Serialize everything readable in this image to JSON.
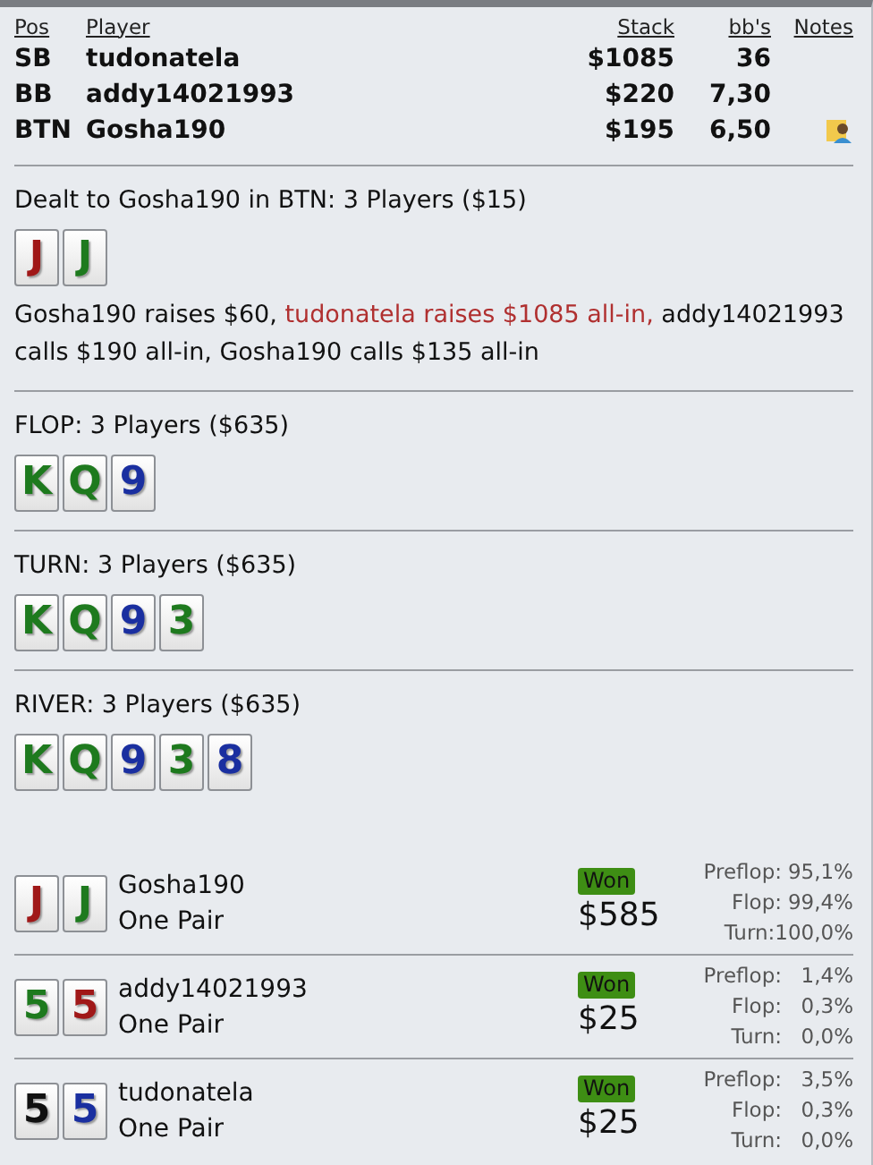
{
  "players_table": {
    "columns": [
      "Pos",
      "Player",
      "Stack",
      "bb's",
      "Notes"
    ],
    "rows": [
      {
        "pos": "SB",
        "player": "tudonatela",
        "stack": "$1085",
        "bbs": "36",
        "has_note": false
      },
      {
        "pos": "BB",
        "player": "addy14021993",
        "stack": "$220",
        "bbs": "7,30",
        "has_note": false
      },
      {
        "pos": "BTN",
        "player": "Gosha190",
        "stack": "$195",
        "bbs": "6,50",
        "has_note": true
      }
    ]
  },
  "streets": [
    {
      "title": "Dealt to Gosha190 in BTN: 3 Players ($15)",
      "cards": [
        {
          "rank": "J",
          "color": "#a01818"
        },
        {
          "rank": "J",
          "color": "#1e7a1e"
        }
      ],
      "actions": [
        {
          "text": "Gosha190 raises $60, ",
          "highlight": false
        },
        {
          "text": "tudonatela raises $1085 all-in,",
          "highlight": true
        },
        {
          "text": " addy14021993 calls $190 all-in, Gosha190 calls $135 all-in",
          "highlight": false
        }
      ]
    },
    {
      "title": "FLOP: 3 Players ($635)",
      "cards": [
        {
          "rank": "K",
          "color": "#1e7a1e"
        },
        {
          "rank": "Q",
          "color": "#1e7a1e"
        },
        {
          "rank": "9",
          "color": "#1a2fa0"
        }
      ]
    },
    {
      "title": "TURN: 3 Players ($635)",
      "cards": [
        {
          "rank": "K",
          "color": "#1e7a1e"
        },
        {
          "rank": "Q",
          "color": "#1e7a1e"
        },
        {
          "rank": "9",
          "color": "#1a2fa0"
        },
        {
          "rank": "3",
          "color": "#1e7a1e"
        }
      ]
    },
    {
      "title": "RIVER: 3 Players ($635)",
      "cards": [
        {
          "rank": "K",
          "color": "#1e7a1e"
        },
        {
          "rank": "Q",
          "color": "#1e7a1e"
        },
        {
          "rank": "9",
          "color": "#1a2fa0"
        },
        {
          "rank": "3",
          "color": "#1e7a1e"
        },
        {
          "rank": "8",
          "color": "#1a2fa0"
        }
      ]
    }
  ],
  "results": [
    {
      "cards": [
        {
          "rank": "J",
          "color": "#a01818"
        },
        {
          "rank": "J",
          "color": "#1e7a1e"
        }
      ],
      "player": "Gosha190",
      "hand": "One Pair",
      "badge": "Won",
      "amount": "$585",
      "equity": [
        {
          "label": "Preflop:",
          "value": "95,1%"
        },
        {
          "label": "Flop:",
          "value": "99,4%"
        },
        {
          "label": "Turn:",
          "value": "100,0%"
        }
      ]
    },
    {
      "cards": [
        {
          "rank": "5",
          "color": "#1e7a1e"
        },
        {
          "rank": "5",
          "color": "#a01818"
        }
      ],
      "player": "addy14021993",
      "hand": "One Pair",
      "badge": "Won",
      "amount": "$25",
      "equity": [
        {
          "label": "Preflop:",
          "value": "1,4%"
        },
        {
          "label": "Flop:",
          "value": "0,3%"
        },
        {
          "label": "Turn:",
          "value": "0,0%"
        }
      ]
    },
    {
      "cards": [
        {
          "rank": "5",
          "color": "#111111"
        },
        {
          "rank": "5",
          "color": "#1a2fa0"
        }
      ],
      "player": "tudonatela",
      "hand": "One Pair",
      "badge": "Won",
      "amount": "$25",
      "equity": [
        {
          "label": "Preflop:",
          "value": "3,5%"
        },
        {
          "label": "Flop:",
          "value": "0,3%"
        },
        {
          "label": "Turn:",
          "value": "0,0%"
        }
      ]
    }
  ]
}
